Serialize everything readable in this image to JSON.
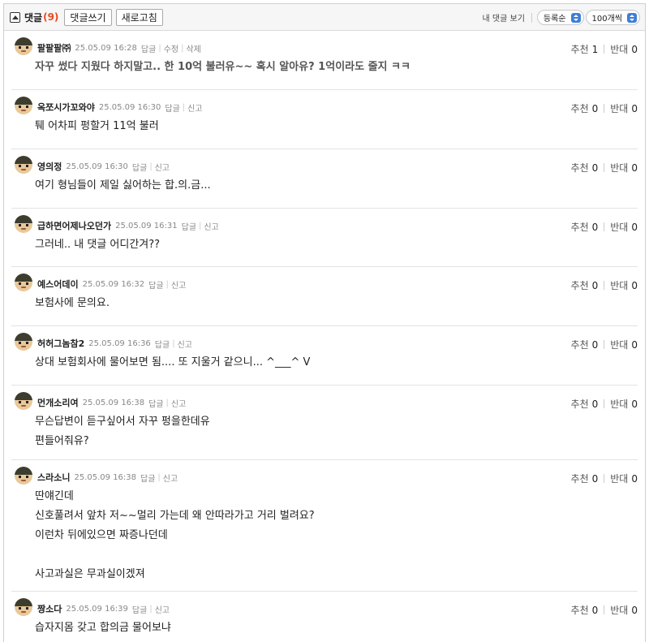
{
  "header": {
    "title": "댓글",
    "count": "(9)",
    "write_label": "댓글쓰기",
    "refresh_label": "새로고침",
    "my_comments_label": "내 댓글 보기",
    "sort_value": "등록순",
    "page_size_value": "100개씩"
  },
  "labels": {
    "reply": "답글",
    "edit": "수정",
    "delete": "삭제",
    "report": "신고",
    "recommend": "추천",
    "oppose": "반대"
  },
  "comments": [
    {
      "nickname": "팔팔팔㈜",
      "time": "25.05.09 16:28",
      "own": true,
      "text": "자꾸 썼다 지웠다 하지말고.. 한 10억 불러유~~ 혹시 알아유? 1억이라도 줄지 ㅋㅋ",
      "recommend": "1",
      "oppose": "0"
    },
    {
      "nickname": "옥쪼시가꼬와야",
      "time": "25.05.09 16:30",
      "own": false,
      "text": "퉤 어차피 펑할거 11억 불러",
      "recommend": "0",
      "oppose": "0"
    },
    {
      "nickname": "영의정",
      "time": "25.05.09 16:30",
      "own": false,
      "text": "여기 형님들이 제일 싫어하는 합.의.금...",
      "recommend": "0",
      "oppose": "0"
    },
    {
      "nickname": "급하면어제나오던가",
      "time": "25.05.09 16:31",
      "own": false,
      "text": "그러네.. 내 댓글 어디간겨??",
      "recommend": "0",
      "oppose": "0"
    },
    {
      "nickname": "예스어데이",
      "time": "25.05.09 16:32",
      "own": false,
      "text": "보험사에 문의요.",
      "recommend": "0",
      "oppose": "0"
    },
    {
      "nickname": "허허그놈참2",
      "time": "25.05.09 16:36",
      "own": false,
      "text": "상대 보험회사에 물어보면 됨.... 또 지울거 같으니... ^___^ V",
      "recommend": "0",
      "oppose": "0"
    },
    {
      "nickname": "먼개소리여",
      "time": "25.05.09 16:38",
      "own": false,
      "text": "무슨답변이 듣구싶어서 자꾸 펑을한데유\n편들어줘유?",
      "recommend": "0",
      "oppose": "0"
    },
    {
      "nickname": "스라소니",
      "time": "25.05.09 16:38",
      "own": false,
      "text": "딴얘긴데\n신호풀려서 앞차 저~~멀리 가는데 왜 안따라가고 거리 벌려요?\n이런차 뒤에있으면 짜증나던데\n\n사고과실은 무과실이겠져",
      "recommend": "0",
      "oppose": "0"
    },
    {
      "nickname": "짱소다",
      "time": "25.05.09 16:39",
      "own": false,
      "text": "습자지몸 갖고 합의금 물어보냐",
      "recommend": "0",
      "oppose": "0"
    }
  ],
  "colors": {
    "count": "#e8491d",
    "select_arrow": "#3d7fd9"
  }
}
